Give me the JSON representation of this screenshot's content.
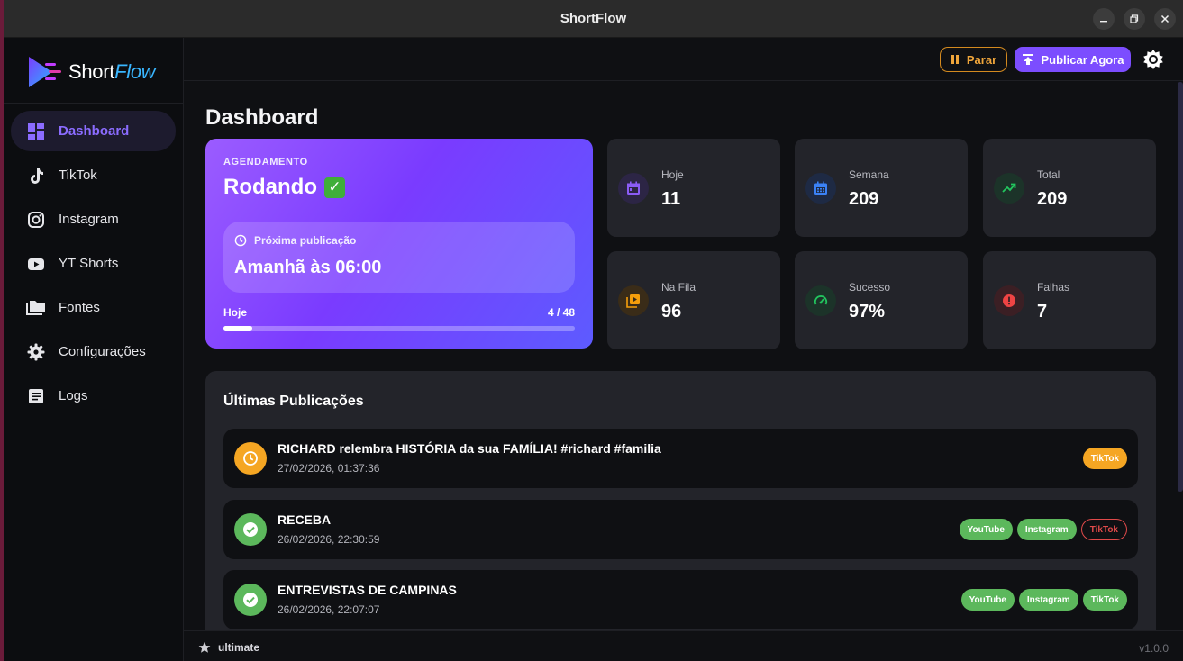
{
  "window": {
    "title": "ShortFlow",
    "controls": [
      "minimize",
      "maximize",
      "close"
    ]
  },
  "brand": {
    "name_part1": "Short",
    "name_part2": "Flow"
  },
  "sidebar": {
    "items": [
      {
        "label": "Dashboard",
        "icon": "dashboard-icon",
        "active": true
      },
      {
        "label": "TikTok",
        "icon": "tiktok-icon"
      },
      {
        "label": "Instagram",
        "icon": "instagram-icon"
      },
      {
        "label": "YT Shorts",
        "icon": "youtube-icon"
      },
      {
        "label": "Fontes",
        "icon": "folder-icon"
      },
      {
        "label": "Configurações",
        "icon": "gear-icon"
      },
      {
        "label": "Logs",
        "icon": "document-icon"
      }
    ]
  },
  "topbar": {
    "stop_label": "Parar",
    "publish_label": "Publicar Agora",
    "theme_icon": "sun-icon"
  },
  "page": {
    "title": "Dashboard"
  },
  "schedule": {
    "overline": "AGENDAMENTO",
    "status": "Rodando",
    "status_emoji": "✓",
    "next_label": "Próxima publicação",
    "next_value": "Amanhã às 06:00",
    "progress_label": "Hoje",
    "progress_text": "4 / 48",
    "progress_fraction": 0.083
  },
  "stats": [
    {
      "label": "Hoje",
      "value": "11",
      "icon": "calendar-day-icon",
      "color": "#8b5cf6"
    },
    {
      "label": "Semana",
      "value": "209",
      "icon": "calendar-week-icon",
      "color": "#3b82f6"
    },
    {
      "label": "Total",
      "value": "209",
      "icon": "trend-up-icon",
      "color": "#22c55e"
    },
    {
      "label": "Na Fila",
      "value": "96",
      "icon": "queue-icon",
      "color": "#f59e0b"
    },
    {
      "label": "Sucesso",
      "value": "97%",
      "icon": "gauge-icon",
      "color": "#22c55e"
    },
    {
      "label": "Falhas",
      "value": "7",
      "icon": "alert-icon",
      "color": "#ef4444"
    }
  ],
  "recent": {
    "title": "Últimas Publicações",
    "items": [
      {
        "title": "RICHARD relembra HISTÓRIA da sua FAMÍLIA! #richard #familia",
        "date": "27/02/2026, 01:37:36",
        "status": "pending",
        "tags": [
          {
            "label": "TikTok",
            "state": "pending"
          }
        ]
      },
      {
        "title": "RECEBA",
        "date": "26/02/2026, 22:30:59",
        "status": "success",
        "tags": [
          {
            "label": "YouTube",
            "state": "ok"
          },
          {
            "label": "Instagram",
            "state": "ok"
          },
          {
            "label": "TikTok",
            "state": "fail"
          }
        ]
      },
      {
        "title": "ENTREVISTAS DE CAMPINAS",
        "date": "26/02/2026, 22:07:07",
        "status": "success",
        "tags": [
          {
            "label": "YouTube",
            "state": "ok"
          },
          {
            "label": "Instagram",
            "state": "ok"
          },
          {
            "label": "TikTok",
            "state": "ok"
          }
        ]
      }
    ]
  },
  "footer": {
    "plan": "ultimate",
    "version": "v1.0.0"
  }
}
